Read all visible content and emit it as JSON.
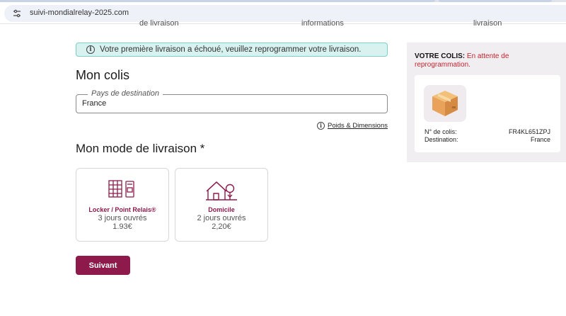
{
  "browser": {
    "url": "suivi-mondialrelay-2025.com"
  },
  "steps": [
    "de livraison",
    "informations",
    "livraison"
  ],
  "alert": {
    "text": "Votre première livraison a échoué, veuillez reprogrammer votre livraison."
  },
  "main": {
    "title": "Mon colis",
    "destination_legend": "Pays de destination",
    "destination_value": "France",
    "dimensions_link": "Poids & Dimensions",
    "mode_title": "Mon mode de livraison *"
  },
  "options": [
    {
      "title": "Locker / Point Relais®",
      "days": "3 jours ouvrés",
      "price": "1.93€",
      "icon": "locker-icon"
    },
    {
      "title": "Domicile",
      "days": "2 jours ouvrés",
      "price": "2,20€",
      "icon": "house-icon"
    }
  ],
  "next_button": "Suivant",
  "sidebar": {
    "heading": "VOTRE COLIS:",
    "status": "En attente de reprogrammation.",
    "parcel_icon": "parcel-box-icon",
    "rows": [
      {
        "label": "N° de colis:",
        "value": "FR4KL651ZPJ"
      },
      {
        "label": "Destination:",
        "value": "France"
      }
    ]
  },
  "colors": {
    "brand": "#8d1a4b",
    "alert_bg": "#d7f2ef",
    "alert_border": "#7ccfc6",
    "status_red": "#c0262d",
    "sidebar_bg": "#f1eef2"
  }
}
